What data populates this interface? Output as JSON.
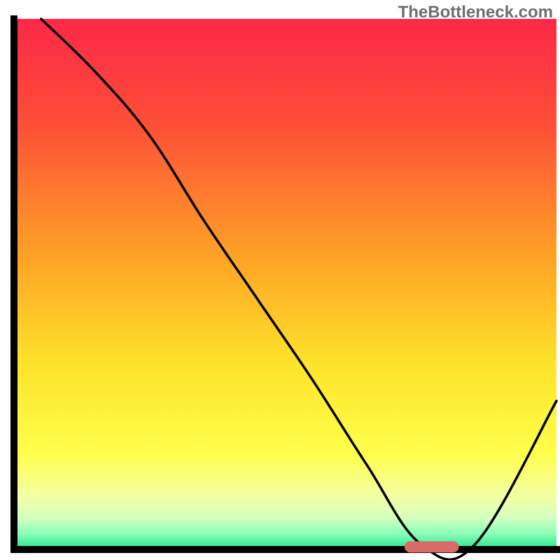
{
  "watermark": "TheBottleneck.com",
  "chart_data": {
    "type": "line",
    "title": "",
    "xlabel": "",
    "ylabel": "",
    "xlim": [
      0,
      100
    ],
    "ylim": [
      0,
      100
    ],
    "x": [
      5,
      15,
      25,
      35,
      45,
      55,
      65,
      75,
      85,
      100
    ],
    "values": [
      100,
      90,
      78,
      62,
      47,
      32,
      16,
      1,
      1,
      28
    ],
    "optimal_marker": {
      "x_start": 72,
      "x_end": 82,
      "y": 0.5
    },
    "background_gradient": {
      "stops": [
        {
          "pct": 0,
          "color": "#fc2948"
        },
        {
          "pct": 20,
          "color": "#fd4f37"
        },
        {
          "pct": 45,
          "color": "#fea326"
        },
        {
          "pct": 65,
          "color": "#fee32a"
        },
        {
          "pct": 82,
          "color": "#feff4b"
        },
        {
          "pct": 90,
          "color": "#f3ffa3"
        },
        {
          "pct": 94,
          "color": "#d4ffbf"
        },
        {
          "pct": 97,
          "color": "#8bffb8"
        },
        {
          "pct": 100,
          "color": "#26e28f"
        }
      ]
    },
    "axis_color": "#000000",
    "curve_color": "#000000",
    "marker_color": "#d96a6a"
  }
}
